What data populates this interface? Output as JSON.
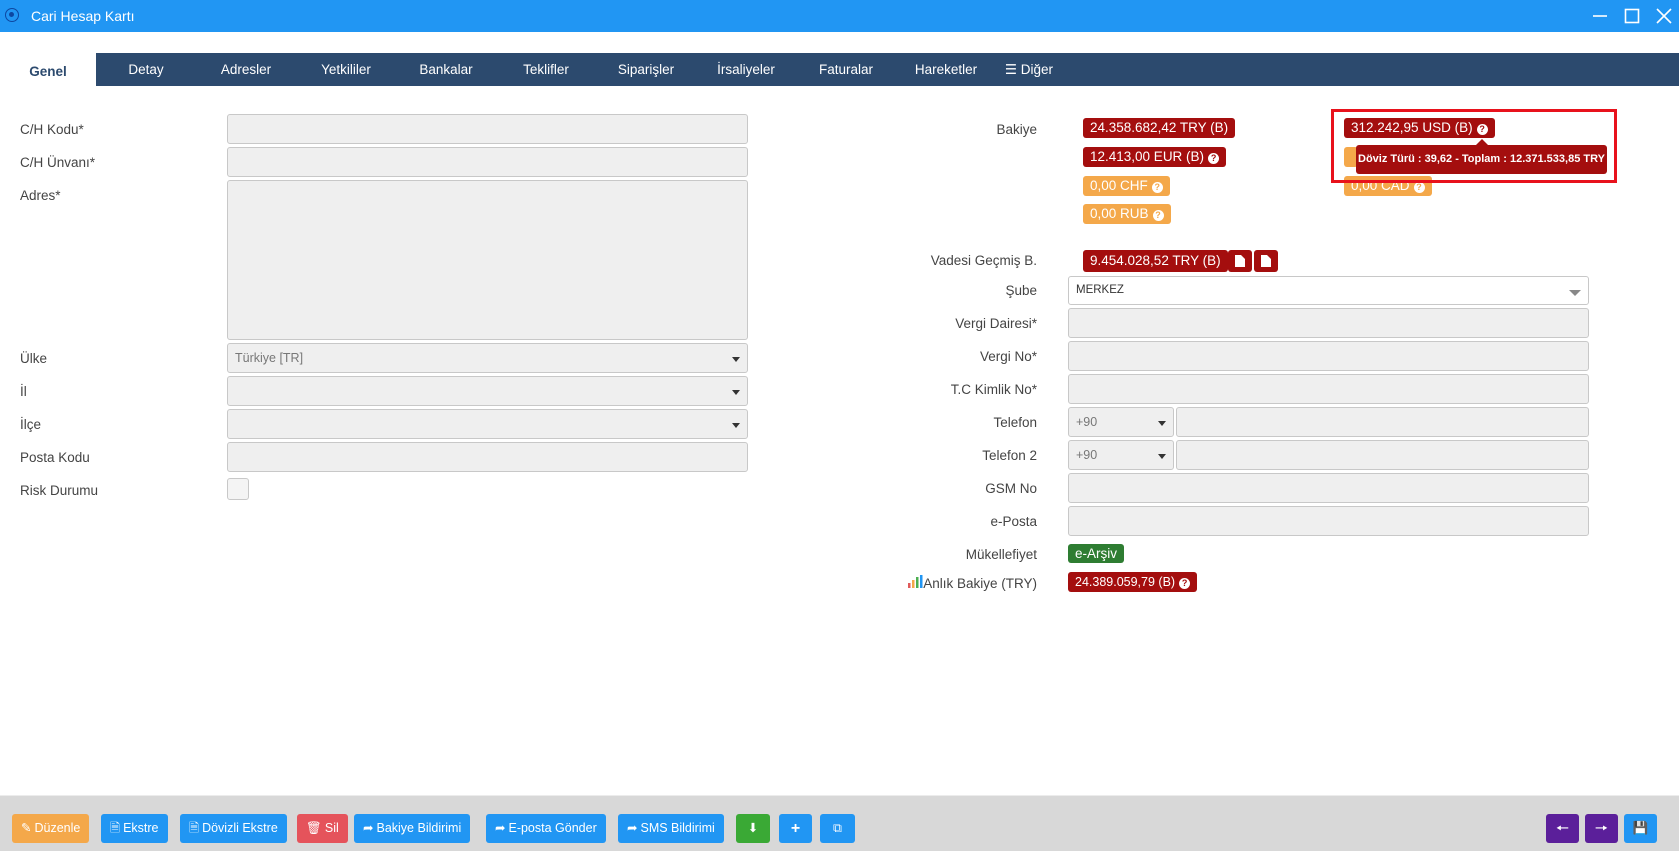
{
  "window": {
    "title": "Cari Hesap Kartı"
  },
  "tabs": [
    "Genel",
    "Detay",
    "Adresler",
    "Yetkililer",
    "Bankalar",
    "Teklifler",
    "Siparişler",
    "İrsaliyeler",
    "Faturalar",
    "Hareketler",
    "Diğer"
  ],
  "left_form": {
    "ch_kodu": "C/H Kodu*",
    "ch_unvani": "C/H Ünvanı*",
    "adres": "Adres*",
    "ulke": "Ülke",
    "ulke_value": "Türkiye [TR]",
    "il": "İl",
    "ilce": "İlçe",
    "posta_kodu": "Posta Kodu",
    "risk_durumu": "Risk Durumu"
  },
  "right_form": {
    "bakiye": "Bakiye",
    "vadesi_gecmis": "Vadesi Geçmiş B.",
    "sube": "Şube",
    "sube_value": "MERKEZ",
    "vergi_dairesi": "Vergi Dairesi*",
    "vergi_no": "Vergi No*",
    "tc_kimlik": "T.C Kimlik No*",
    "telefon": "Telefon",
    "telefon_code": "+90",
    "telefon2": "Telefon 2",
    "telefon2_code": "+90",
    "gsm_no": "GSM No",
    "eposta": "e-Posta",
    "mukellefiyet": "Mükellefiyet",
    "mukellefiyet_value": "e-Arşiv",
    "anlik_bakiye": "Anlık Bakiye (TRY)",
    "anlik_bakiye_value": "24.389.059,79 (B)"
  },
  "balances": {
    "try": "24.358.682,42 TRY (B)",
    "usd": "312.242,95 USD (B)",
    "eur": "12.413,00 EUR (B)",
    "chf": "0,00 CHF",
    "cad": "0,00 CAD",
    "rub": "0,00 RUB",
    "overdue": "9.454.028,52 TRY (B)"
  },
  "tooltip": "Döviz Türü : 39,62 - Toplam : 12.371.533,85 TRY",
  "footer": {
    "duzenle": "Düzenle",
    "ekstre": "Ekstre",
    "dovizli_ekstre": "Dövizli Ekstre",
    "sil": "Sil",
    "bakiye_bildirimi": "Bakiye Bildirimi",
    "eposta_gonder": "E-posta Gönder",
    "sms_bildirimi": "SMS Bildirimi"
  }
}
